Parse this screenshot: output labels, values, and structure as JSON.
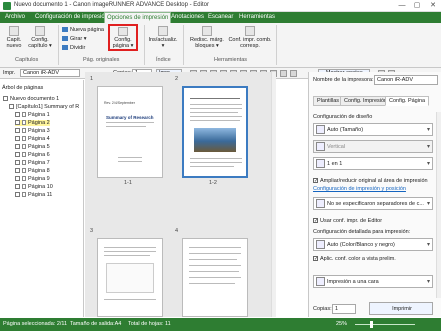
{
  "window": {
    "title": "Nuevo documento 1 - Canon imageRUNNER ADVANCE Desktop - Editor",
    "minimize": "—",
    "maximize": "▢",
    "close": "✕"
  },
  "ribbon_tabs": [
    "Archivo",
    "Configuración de impresión",
    "Opciones de impresión",
    "Anotaciones",
    "Escanear",
    "Herramientas"
  ],
  "ribbon": {
    "capitulo_nuevo": [
      "Capít.",
      "nuevo"
    ],
    "config_capitulo": [
      "Config.",
      "capítulo ▾"
    ],
    "grp_capitulos": "Capítulos",
    "nueva_pagina": "Nueva página",
    "girar": "Girar ▾",
    "dividir": "Dividir",
    "config_pagina": [
      "Config.",
      "página ▾"
    ],
    "grp_pag_originales": "Pág. originales",
    "ins_actualiz": [
      "Ins/actualiz.",
      "▾"
    ],
    "grp_indice": "Índice",
    "redistr": [
      "Redisc. márg.",
      "bloques ▾"
    ],
    "conf_impr": [
      "Conf. impr. comb.",
      "corresp."
    ],
    "grp_herramientas": "Herramientas"
  },
  "toolbar2": {
    "impr_label": "Impr.",
    "printer": "Canon iR-ADV",
    "copias_label": "Copias:",
    "copias_value": "1",
    "impr_btn": "Impr.",
    "mostrar_anotac": "Mostrar anotac."
  },
  "left_panel": {
    "header": "Árbol de páginas",
    "root": "Nuevo documento 1",
    "chapter": "[Capítulo1] Summary of R",
    "pages": [
      "Página 1",
      "Página 2",
      "Página 3",
      "Página 4",
      "Página 5",
      "Página 6",
      "Página 7",
      "Página 8",
      "Página 9",
      "Página 10",
      "Página 11"
    ]
  },
  "center": {
    "thumbs": [
      {
        "num": "1",
        "label": "1-1",
        "title": "Summary of Research",
        "header": "Rev. 2/4/September"
      },
      {
        "num": "2",
        "label": "1-2"
      },
      {
        "num": "3",
        "label": ""
      },
      {
        "num": "4",
        "label": ""
      }
    ]
  },
  "right_panel": {
    "printer_label": "Nombre de la impresora:",
    "printer_value": "Canon iR-ADV",
    "tabs": [
      "Plantillas",
      "Config. Impresión",
      "Config. Página"
    ],
    "diseno_label": "Configuración de diseño",
    "diseno_value": "Auto (Tamaño)",
    "orient_value": "Vertical",
    "uno_en_uno": "1 en 1",
    "ampliar_label": "Ampliar/reducir original al área de impresión",
    "link_impresion": "Configuración de impresión y posición",
    "separadores": "No se especificaron separadores de c...",
    "user_conf": "Usar conf. impr. de Editor",
    "detallada_label": "Configuración detallada para impresión:",
    "color_value": "Auto (Color/Blanco y negro)",
    "aplic_label": "Aplic. conf. color a vista prelim.",
    "impresion_cara": "Impresión a una cara",
    "copias_label": "Copias:",
    "copias_value": "1",
    "imprimir": "Imprimir"
  },
  "status": {
    "selected": "Página seleccionada: 2/11",
    "output_size": "Tamaño de salida:A4",
    "total": "Total de hojas: 11",
    "zoom": "25%"
  },
  "colors": {
    "accent": "#2e7d32",
    "highlight": "#e02020",
    "selected_row": "#fff59d"
  }
}
